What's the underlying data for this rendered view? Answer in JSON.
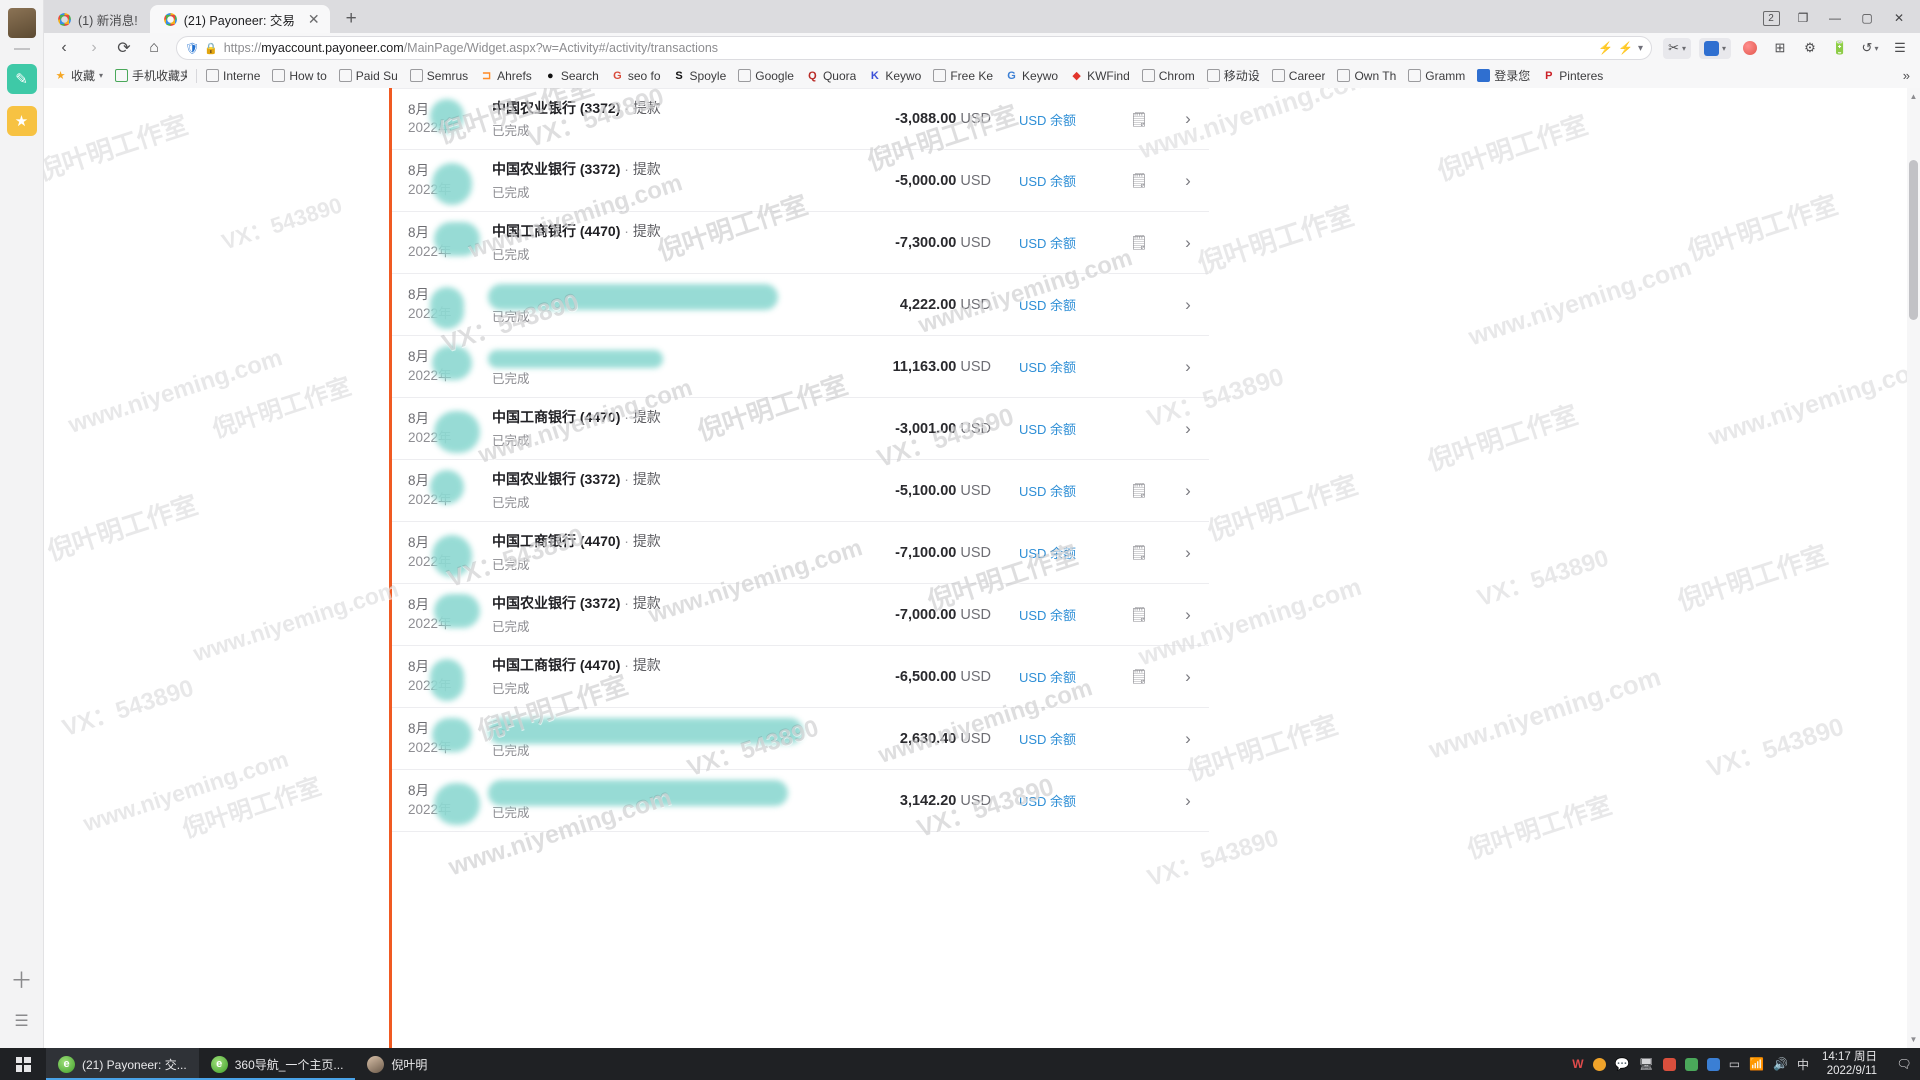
{
  "browser": {
    "tabs": [
      {
        "title": "(1) 新消息!",
        "active": false,
        "closable": false
      },
      {
        "title": "(21) Payoneer: 交易",
        "active": true,
        "closable": true
      }
    ],
    "new_tab_label": "+",
    "window_controls": {
      "profile_count": "2",
      "minimize": "—",
      "maximize": "▢",
      "close": "✕"
    },
    "nav": {
      "back": "‹",
      "forward": "›",
      "reload": "⟳",
      "home": "⌂"
    },
    "omnibox": {
      "url_scheme": "https://",
      "url_host": "myaccount.payoneer.com",
      "url_path": "/MainPage/Widget.aspx?w=Activity#/activity/transactions",
      "lock_icon": "lock-icon",
      "shield_icon": "shield-icon"
    },
    "toolbar_right": [
      "scissors-icon",
      "translate-icon",
      "pin-icon",
      "apps-grid-icon",
      "settings-gear-icon",
      "battery-icon",
      "undo-icon",
      "menu-icon"
    ],
    "bookmarks": [
      {
        "label": "收藏",
        "icon": "star-icon"
      },
      {
        "label": "手机收藏夹",
        "icon": "folder-icon"
      },
      {
        "label": "Interne",
        "icon": "page-icon"
      },
      {
        "label": "How to",
        "icon": "page-icon"
      },
      {
        "label": "Paid Su",
        "icon": "page-icon"
      },
      {
        "label": "Semrus",
        "icon": "page-icon"
      },
      {
        "label": "Ahrefs",
        "icon": "ahrefs-icon"
      },
      {
        "label": "Search",
        "icon": "black-dot-icon"
      },
      {
        "label": "seo fo",
        "icon": "google-icon"
      },
      {
        "label": "Spoyle",
        "icon": "s-icon"
      },
      {
        "label": "Google",
        "icon": "page-icon"
      },
      {
        "label": "Quora",
        "icon": "quora-icon"
      },
      {
        "label": "Keywo",
        "icon": "k-icon"
      },
      {
        "label": "Free Ke",
        "icon": "page-icon"
      },
      {
        "label": "Keywo",
        "icon": "google-icon"
      },
      {
        "label": "KWFind",
        "icon": "red-drop-icon"
      },
      {
        "label": "Chrom",
        "icon": "page-icon"
      },
      {
        "label": "移动设",
        "icon": "page-icon"
      },
      {
        "label": "Career",
        "icon": "page-icon"
      },
      {
        "label": "Own Th",
        "icon": "page-icon"
      },
      {
        "label": "Gramm",
        "icon": "page-icon"
      },
      {
        "label": "登录您",
        "icon": "blue-square-icon"
      },
      {
        "label": "Pinteres",
        "icon": "pinterest-icon"
      }
    ],
    "bookmarks_overflow": "»"
  },
  "transactions": {
    "currency": "USD",
    "account_label": "USD 余额",
    "status_done": "已完成",
    "month_label": "8月",
    "year_label": "2022年",
    "withdrawal_label": "提款",
    "separator": "·",
    "chevron": "›",
    "note_icon": "note-icon",
    "rows": [
      {
        "date_day": "8月",
        "date_year": "2022年",
        "title": "中国农业银行 (3372)",
        "type": "提款",
        "status": "已完成",
        "amount": "-3,088.00",
        "currency": "USD",
        "account": "USD 余额",
        "has_note": true,
        "redacted_title": false
      },
      {
        "date_day": "8月",
        "date_year": "2022年",
        "title": "中国农业银行 (3372)",
        "type": "提款",
        "status": "已完成",
        "amount": "-5,000.00",
        "currency": "USD",
        "account": "USD 余额",
        "has_note": true,
        "redacted_title": false
      },
      {
        "date_day": "8月",
        "date_year": "2022年",
        "title": "中国工商银行 (4470)",
        "type": "提款",
        "status": "已完成",
        "amount": "-7,300.00",
        "currency": "USD",
        "account": "USD 余额",
        "has_note": true,
        "redacted_title": false
      },
      {
        "date_day": "8月",
        "date_year": "2022年",
        "title": "",
        "type": "",
        "status": "已完成",
        "amount": "4,222.00",
        "currency": "USD",
        "account": "USD 余额",
        "has_note": false,
        "redacted_title": true
      },
      {
        "date_day": "8月",
        "date_year": "2022年",
        "title": "",
        "type": "",
        "status": "已完成",
        "amount": "11,163.00",
        "currency": "USD",
        "account": "USD 余额",
        "has_note": false,
        "redacted_title": true
      },
      {
        "date_day": "8月",
        "date_year": "2022年",
        "title": "中国工商银行 (4470)",
        "type": "提款",
        "status": "已完成",
        "amount": "-3,001.00",
        "currency": "USD",
        "account": "USD 余额",
        "has_note": false,
        "redacted_title": false
      },
      {
        "date_day": "8月",
        "date_year": "2022年",
        "title": "中国农业银行 (3372)",
        "type": "提款",
        "status": "已完成",
        "amount": "-5,100.00",
        "currency": "USD",
        "account": "USD 余额",
        "has_note": true,
        "redacted_title": false
      },
      {
        "date_day": "8月",
        "date_year": "2022年",
        "title": "中国工商银行 (4470)",
        "type": "提款",
        "status": "已完成",
        "amount": "-7,100.00",
        "currency": "USD",
        "account": "USD 余额",
        "has_note": true,
        "redacted_title": false
      },
      {
        "date_day": "8月",
        "date_year": "2022年",
        "title": "中国农业银行 (3372)",
        "type": "提款",
        "status": "已完成",
        "amount": "-7,000.00",
        "currency": "USD",
        "account": "USD 余额",
        "has_note": true,
        "redacted_title": false
      },
      {
        "date_day": "8月",
        "date_year": "2022年",
        "title": "中国工商银行 (4470)",
        "type": "提款",
        "status": "已完成",
        "amount": "-6,500.00",
        "currency": "USD",
        "account": "USD 余额",
        "has_note": true,
        "redacted_title": false
      },
      {
        "date_day": "8月",
        "date_year": "2022年",
        "title": "",
        "type": "",
        "status": "已完成",
        "amount": "2,630.40",
        "currency": "USD",
        "account": "USD 余额",
        "has_note": false,
        "redacted_title": true
      },
      {
        "date_day": "8月",
        "date_year": "2022年",
        "title": "",
        "type": "",
        "status": "已完成",
        "amount": "3,142.20",
        "currency": "USD",
        "account": "USD 余额",
        "has_note": false,
        "redacted_title": true
      }
    ]
  },
  "watermarks": {
    "studio": "倪叶明工作室",
    "wechat": "VX：543890",
    "site": "www.niyeming.com"
  },
  "taskbar": {
    "start_icon": "windows-start-icon",
    "items": [
      {
        "label": "(21) Payoneer: 交...",
        "icon": "ie-icon",
        "selected": true
      },
      {
        "label": "360导航_一个主页...",
        "icon": "ie-icon",
        "selected": false
      },
      {
        "label": "倪叶明",
        "icon": "avatar-icon",
        "selected": false
      }
    ],
    "tray": [
      "w-icon",
      "orange-circle-icon",
      "chat-icon",
      "monitor-icon",
      "shield-icon",
      "bluetooth-icon",
      "display-icon",
      "cloud-icon",
      "wifi-icon",
      "speaker-icon",
      "ime-cn-icon",
      "ime-label"
    ],
    "ime": "中",
    "clock_time": "14:17 周日",
    "clock_date": "2022/9/11",
    "notification_icon": "notification-icon"
  },
  "colors": {
    "accent_orange": "#f05a22",
    "link_blue": "#2f8fd6",
    "redact_teal": "#8fd9d2",
    "taskbar_bg": "#1f2124",
    "tab_active_bg": "#f8f8f9"
  }
}
